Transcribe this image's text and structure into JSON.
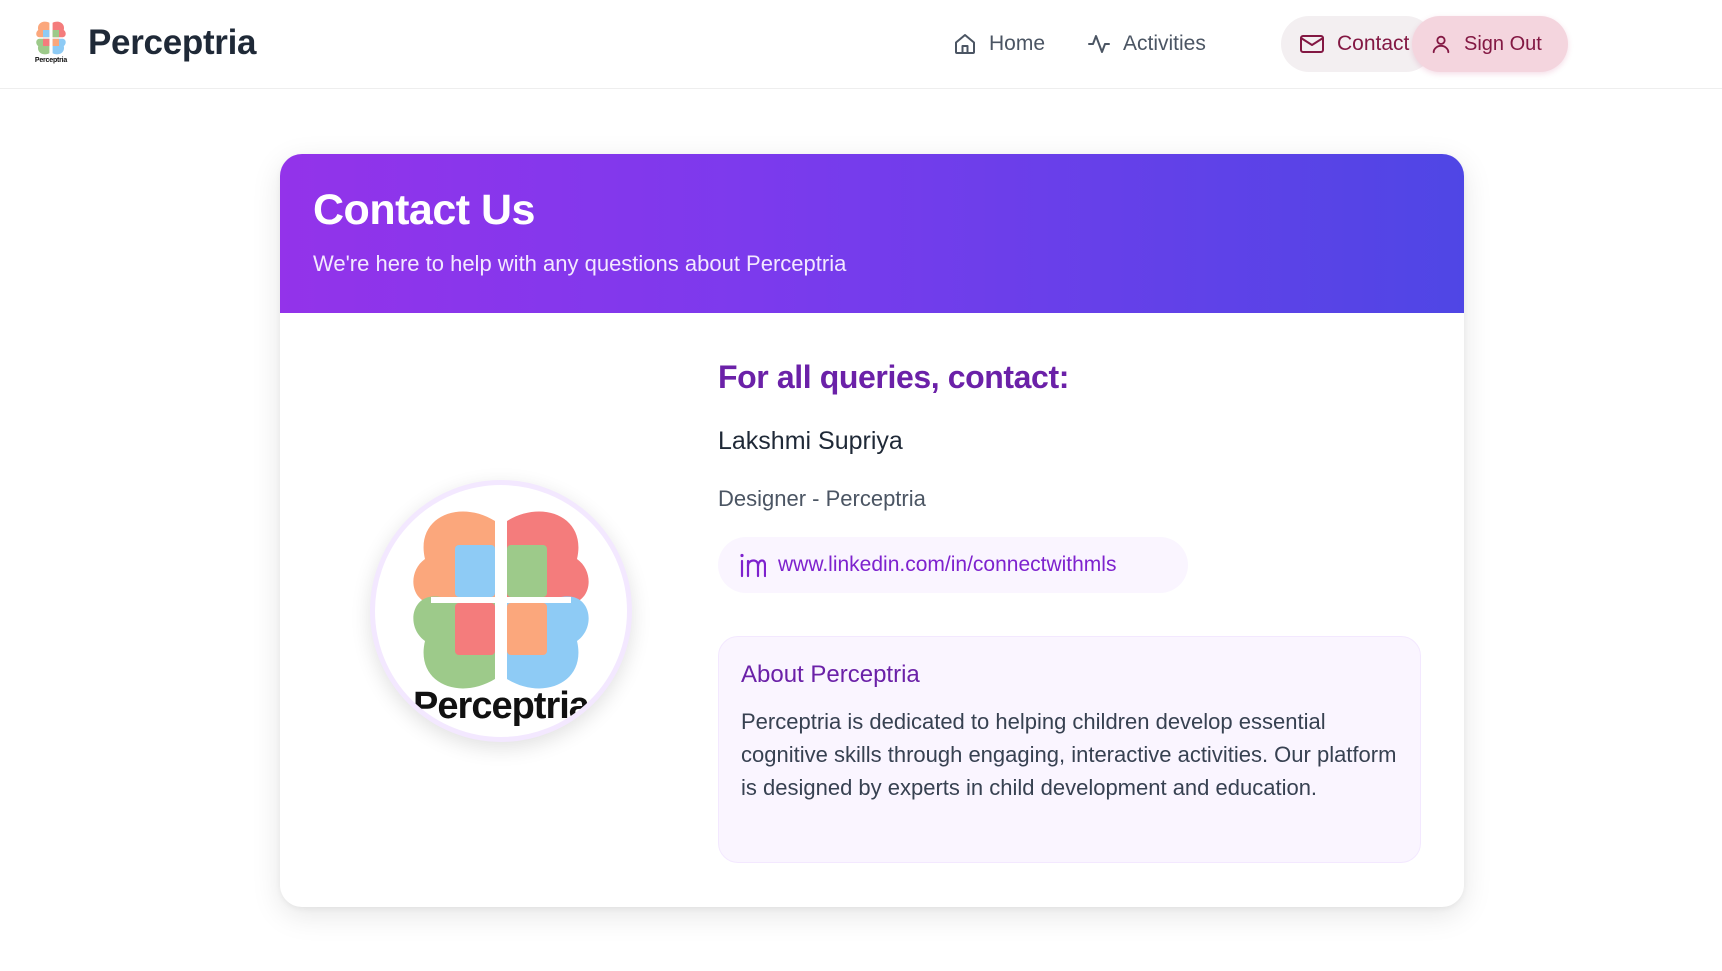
{
  "header": {
    "brand_name": "Perceptria",
    "logo_caption": "Perceptria"
  },
  "nav": {
    "home": {
      "label": "Home",
      "icon": "home-icon"
    },
    "activities": {
      "label": "Activities",
      "icon": "activity-icon"
    },
    "contact": {
      "label": "Contact",
      "icon": "mail-icon",
      "active": true
    },
    "sign_out": {
      "label": "Sign Out",
      "icon": "user-icon"
    }
  },
  "contact_card": {
    "title": "Contact Us",
    "subtitle": "We're here to help with any questions about Perceptria",
    "logo_caption": "Perceptria",
    "queries_heading": "For all queries, contact:",
    "name": "Lakshmi Supriya",
    "role": "Designer - Perceptria",
    "linkedin": "www.linkedin.com/in/connectwithmls",
    "about": {
      "title": "About Perceptria",
      "body": "Perceptria is dedicated to helping children develop essential cognitive skills through engaging, interactive activities. Our platform is designed by experts in child development and education."
    }
  },
  "colors": {
    "header_gradient_start": "#9333ea",
    "header_gradient_end": "#4f46e5",
    "accent_purple": "#6b21a8",
    "sign_out_bg": "#f4d5de",
    "logo_orange": "#fba77c",
    "logo_red": "#f47c7c",
    "logo_blue": "#8ecbf5",
    "logo_green": "#9dca8a"
  }
}
